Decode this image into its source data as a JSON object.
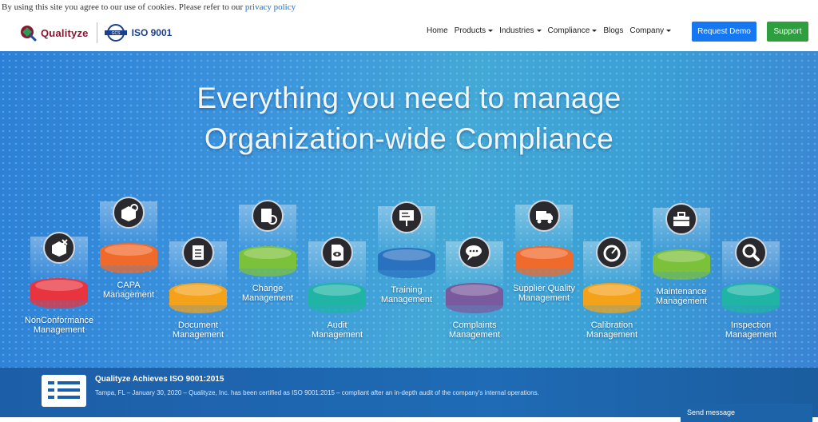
{
  "cookie": {
    "text": "By using this site you agree to our use of cookies. Please refer to our ",
    "link": "privacy policy"
  },
  "header": {
    "brand": "Qualityze",
    "iso": "ISO 9001",
    "nav": [
      "Home",
      "Products",
      "Industries",
      "Compliance",
      "Blogs",
      "Company"
    ],
    "request_demo": "Request Demo",
    "support": "Support"
  },
  "hero": {
    "title_line1": "Everything you need to manage",
    "title_line2": "Organization-wide Compliance"
  },
  "modules": [
    {
      "label1": "NonConformance",
      "label2": "Management",
      "color": "#e8343f",
      "icon": "box-x-icon"
    },
    {
      "label1": "CAPA",
      "label2": "Management",
      "color": "#ef6a2b",
      "icon": "box-refresh-icon"
    },
    {
      "label1": "Document",
      "label2": "Management",
      "color": "#f4a21a",
      "icon": "document-icon"
    },
    {
      "label1": "Change",
      "label2": "Management",
      "color": "#7cc13a",
      "icon": "doc-change-icon"
    },
    {
      "label1": "Audit",
      "label2": "Management",
      "color": "#1fb4a4",
      "icon": "eye-doc-icon"
    },
    {
      "label1": "Training",
      "label2": "Management",
      "color": "#2a72c0",
      "icon": "presentation-icon"
    },
    {
      "label1": "Complaints",
      "label2": "Management",
      "color": "#7a5a9e",
      "icon": "chat-icon"
    },
    {
      "label1": "Supplier Quality",
      "label2": "Management",
      "color": "#ef6a2b",
      "icon": "truck-icon"
    },
    {
      "label1": "Calibration",
      "label2": "Management",
      "color": "#f4a21a",
      "icon": "gauge-icon"
    },
    {
      "label1": "Maintenance",
      "label2": "Management",
      "color": "#7cc13a",
      "icon": "toolbox-icon"
    },
    {
      "label1": "Inspection",
      "label2": "Management",
      "color": "#1fb4a4",
      "icon": "magnifier-icon"
    }
  ],
  "news": {
    "title": "Qualityze Achieves ISO 9001:2015",
    "body": "Tampa, FL – January 30, 2020 – Qualityze, Inc. has been certified as ISO 9001:2015 – compliant after an in-depth audit of the company's internal operations."
  },
  "chat": {
    "label": "Send message"
  }
}
